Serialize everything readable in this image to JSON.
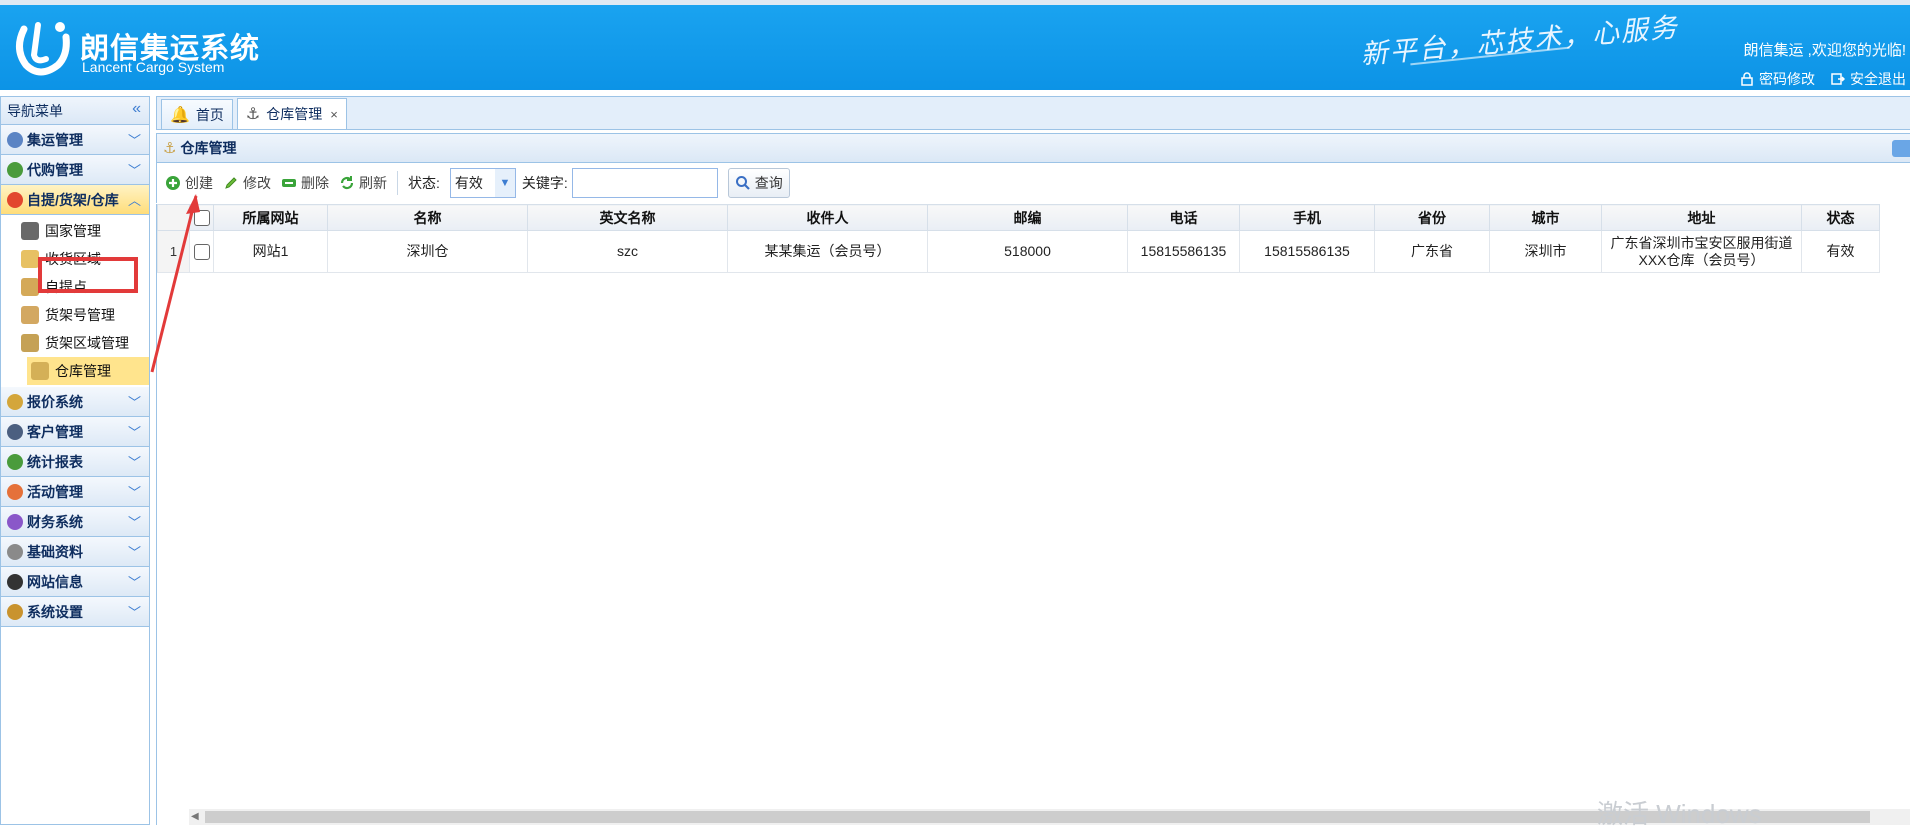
{
  "header": {
    "logo_cn": "朗信集运系统",
    "logo_en": "Lancent Cargo System",
    "slogan": "新平台，芯技术，心服务",
    "welcome": "朗信集运 ,欢迎您的光临!",
    "links": [
      "密码修改",
      "安全退出"
    ]
  },
  "sidebar": {
    "title": "导航菜单",
    "groups": [
      {
        "label": "集运管理",
        "icon": "computer-icon",
        "color": "#5b84c4"
      },
      {
        "label": "代购管理",
        "icon": "globe-icon",
        "color": "#4a9b3c"
      },
      {
        "label": "自提/货架/仓库",
        "icon": "red-ball-icon",
        "color": "#e2472e",
        "active": true,
        "items": [
          {
            "label": "国家管理",
            "icon": "soccer-ball-icon",
            "color": "#444"
          },
          {
            "label": "收货区域",
            "icon": "lock-icon",
            "color": "#e1b13c"
          },
          {
            "label": "自提点",
            "icon": "unlock-icon",
            "color": "#c9932e"
          },
          {
            "label": "货架号管理",
            "icon": "box-icon",
            "color": "#c8923a"
          },
          {
            "label": "货架区域管理",
            "icon": "coin-icon",
            "color": "#b7892a"
          },
          {
            "label": "仓库管理",
            "icon": "anchor-icon",
            "color": "#c9a24a",
            "selected": true
          }
        ]
      },
      {
        "label": "报价系统",
        "icon": "money-icon",
        "color": "#d4a63b"
      },
      {
        "label": "客户管理",
        "icon": "user-icon",
        "color": "#4b5f80"
      },
      {
        "label": "统计报表",
        "icon": "chart-globe-icon",
        "color": "#4a9b3c"
      },
      {
        "label": "活动管理",
        "icon": "rainbow-icon",
        "color": "#e5713a"
      },
      {
        "label": "财务系统",
        "icon": "color-wheel-icon",
        "color": "#8a57c9"
      },
      {
        "label": "基础资料",
        "icon": "stack-icon",
        "color": "#8a8a8a"
      },
      {
        "label": "网站信息",
        "icon": "font-icon",
        "color": "#333"
      },
      {
        "label": "系统设置",
        "icon": "wrench-icon",
        "color": "#c9932e"
      }
    ]
  },
  "tabs": [
    {
      "label": "首页",
      "icon": "bell-icon",
      "active": false
    },
    {
      "label": "仓库管理",
      "icon": "anchor-icon",
      "active": true
    }
  ],
  "panel": {
    "title": "仓库管理"
  },
  "toolbar": {
    "buttons": [
      "创建",
      "修改",
      "删除",
      "刷新"
    ],
    "status_label": "状态:",
    "status_value": "有效",
    "keyword_label": "关键字:",
    "keyword_value": "",
    "search_label": "查询"
  },
  "grid": {
    "columns": [
      "所属网站",
      "名称",
      "英文名称",
      "收件人",
      "邮编",
      "电话",
      "手机",
      "省份",
      "城市",
      "地址",
      "状态"
    ],
    "rows": [
      {
        "row_number": "1",
        "cells": [
          "网站1",
          "深圳仓",
          "szc",
          "某某集运（会员号）",
          "518000",
          "15815586135",
          "15815586135",
          "广东省",
          "深圳市",
          "广东省深圳市宝安区服用街道XXX仓库（会员号）",
          "有效"
        ]
      }
    ]
  },
  "watermark": "激活 Windows"
}
